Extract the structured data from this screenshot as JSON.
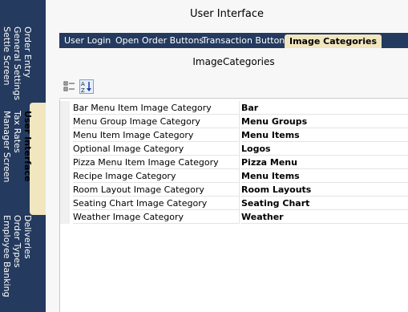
{
  "colors": {
    "nav_bg": "#243a5e",
    "active_tab_bg": "#f1e6c0",
    "page_bg": "#f7f7f7"
  },
  "side_tabs": [
    {
      "lines": [
        "Order Entry",
        "General Settings",
        "Settle Screen"
      ]
    },
    {
      "lines": [
        "User Interface",
        "Tax Rates",
        "Manager Screen"
      ]
    },
    {
      "lines": [
        "Deliveries",
        "Order Types",
        "Employee Banking"
      ]
    }
  ],
  "page": {
    "title": "User Interface",
    "tabs": [
      "User Login",
      "Open Order Buttons",
      "Transaction Buttons",
      "Image Categories"
    ],
    "grid_title": "ImageCategories",
    "toolbar": {
      "categorized_icon": "categorized-view-icon",
      "alphabetical_icon": "sort-alphabetical-icon"
    },
    "rows": [
      {
        "name": "Bar Menu Item Image Category",
        "value": "Bar"
      },
      {
        "name": "Menu Group Image Category",
        "value": "Menu Groups"
      },
      {
        "name": "Menu Item Image Category",
        "value": "Menu Items"
      },
      {
        "name": "Optional Image Category",
        "value": "Logos"
      },
      {
        "name": "Pizza Menu Item Image Category",
        "value": "Pizza Menu"
      },
      {
        "name": "Recipe Image Category",
        "value": "Menu Items"
      },
      {
        "name": "Room Layout Image Category",
        "value": "Room Layouts"
      },
      {
        "name": "Seating Chart Image Category",
        "value": "Seating Chart"
      },
      {
        "name": "Weather Image Category",
        "value": "Weather"
      }
    ]
  }
}
